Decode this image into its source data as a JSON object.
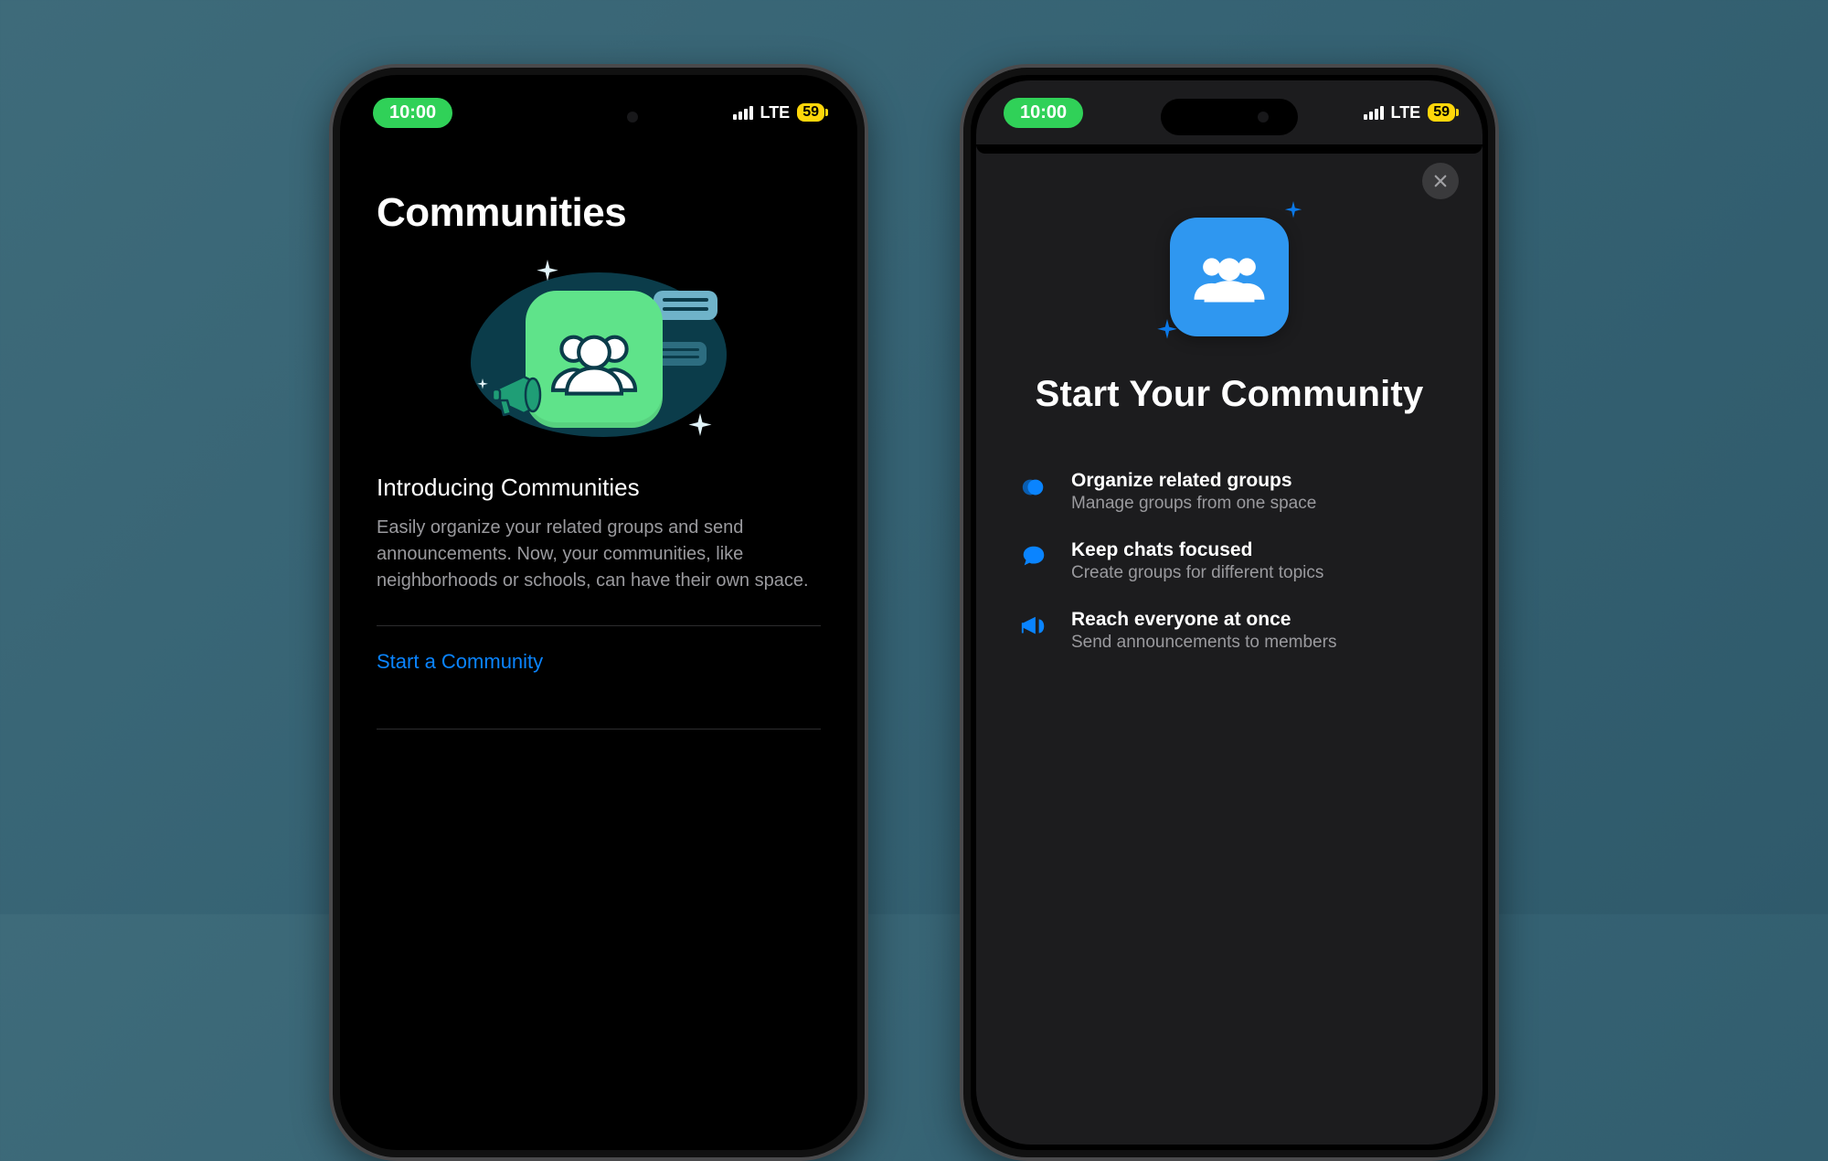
{
  "status": {
    "time": "10:00",
    "network": "LTE",
    "battery": "59"
  },
  "colors": {
    "accent_green": "#30d158",
    "accent_blue": "#0a84ff",
    "battery_yellow": "#ffd60a",
    "hero_blue": "#2f97f0"
  },
  "left": {
    "title": "Communities",
    "illustration": "communities-group-illustration",
    "subhead": "Introducing Communities",
    "body": "Easily organize your related groups and send announcements. Now, your communities, like neighborhoods or schools, can have their own space.",
    "cta": "Start a Community"
  },
  "right": {
    "close": "Close",
    "hero_icon": "group-icon",
    "title": "Start Your Community",
    "features": [
      {
        "icon": "stacked-circles-icon",
        "title": "Organize related groups",
        "desc": "Manage groups from one space"
      },
      {
        "icon": "chat-bubble-icon",
        "title": "Keep chats focused",
        "desc": "Create groups for different topics"
      },
      {
        "icon": "megaphone-icon",
        "title": "Reach everyone at once",
        "desc": "Send announcements to members"
      }
    ]
  }
}
